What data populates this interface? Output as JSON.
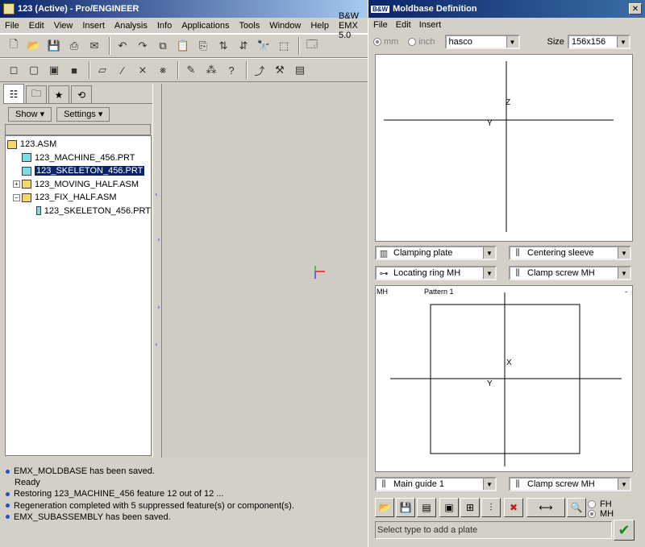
{
  "main": {
    "title": "123 (Active) - Pro/ENGINEER",
    "menu": [
      "File",
      "Edit",
      "View",
      "Insert",
      "Analysis",
      "Info",
      "Applications",
      "Tools",
      "Window",
      "Help",
      "B&W EMX 5.0"
    ],
    "nav": {
      "show_label": "Show ▾",
      "settings_label": "Settings ▾"
    },
    "tree": [
      {
        "label": "123.ASM",
        "type": "asm",
        "indent": 0
      },
      {
        "label": "123_MACHINE_456.PRT",
        "type": "prt",
        "indent": 1
      },
      {
        "label": "123_SKELETON_456.PRT",
        "type": "prt",
        "indent": 1,
        "selected": true
      },
      {
        "label": "123_MOVING_HALF.ASM",
        "type": "asm",
        "indent": 1,
        "expand": "+"
      },
      {
        "label": "123_FIX_HALF.ASM",
        "type": "asm",
        "indent": 1,
        "expand": "−"
      },
      {
        "label": "123_SKELETON_456.PRT",
        "type": "prt",
        "indent": 2
      }
    ],
    "messages": [
      {
        "text": "EMX_MOLDBASE has been saved.",
        "bullet": true
      },
      {
        "text": "Ready",
        "bullet": false
      },
      {
        "text": "Restoring 123_MACHINE_456 feature 12 out of 12 ...",
        "bullet": true
      },
      {
        "text": "Regeneration completed with 5 suppressed feature(s) or component(s).",
        "bullet": true
      },
      {
        "text": "EMX_SUBASSEMBLY has been saved.",
        "bullet": true
      }
    ]
  },
  "dialog": {
    "title": "Moldbase Definition",
    "menu": [
      "File",
      "Edit",
      "Insert"
    ],
    "units": {
      "mm": "mm",
      "inch": "inch"
    },
    "supplier": "hasco",
    "size_label": "Size",
    "size_value": "156x156",
    "top_view": {
      "z": "Z",
      "y": "Y"
    },
    "combos_mid": [
      "Clamping plate",
      "Centering sleeve",
      "Locating ring MH",
      "Clamp screw MH"
    ],
    "bottom_view": {
      "mh": "MH",
      "pattern": "Pattern 1",
      "dash": "-",
      "x": "X",
      "y": "Y"
    },
    "combos_bottom": [
      "Main guide 1",
      "Clamp screw MH"
    ],
    "side_options": {
      "fh": "FH",
      "mh": "MH"
    },
    "status_hint": "Select type to add a plate"
  }
}
